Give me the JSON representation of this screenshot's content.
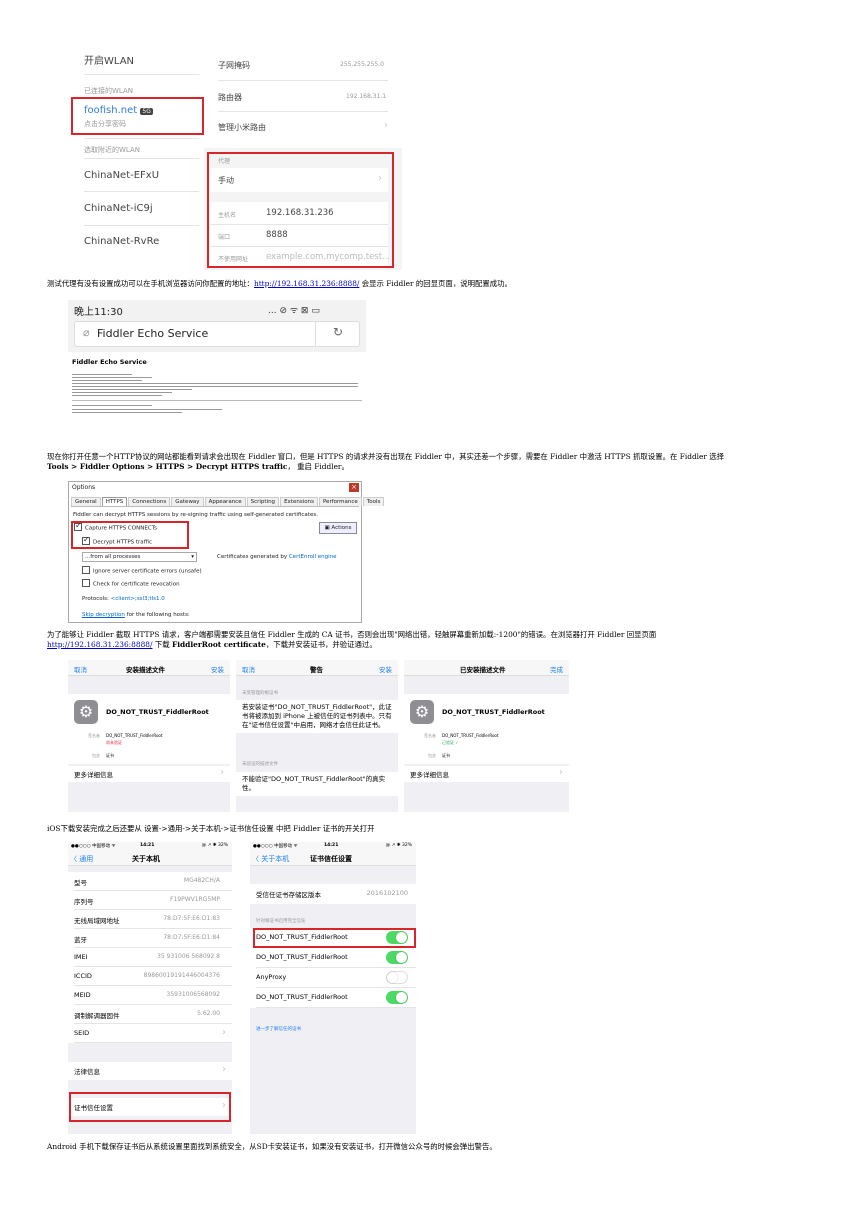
{
  "wifi": {
    "open_wlan": "开启WLAN",
    "connected_header": "已连接的WLAN",
    "network_name": "foofish.net",
    "network_badge": "5G",
    "network_sub": "点击分享密码",
    "choose_header": "选取附近的WLAN",
    "networks": [
      "ChinaNet-EFxU",
      "ChinaNet-iC9j",
      "ChinaNet-RvRe"
    ],
    "subnet_label": "子网掩码",
    "subnet_value": "255.255.255.0",
    "router_label": "路由器",
    "router_value": "192.168.31.1",
    "manage_label": "管理小米路由",
    "proxy_header": "代理",
    "proxy_mode": "手动",
    "host_label": "主机名",
    "host_value": "192.168.31.236",
    "port_label": "端口",
    "port_value": "8888",
    "bypass_label": "不使用网址",
    "bypass_placeholder": "example.com,mycomp.test..."
  },
  "para1": {
    "before": "测试代理有没有设置成功可以在手机浏览器访问你配置的地址：",
    "link": "http://192.168.31.236:8888/",
    "after": " 会显示 Fiddler 的回显页面，说明配置成功。"
  },
  "echo": {
    "time": "晚上11:30",
    "status_icons": "... ⊘ ᯤ ⊠ ▭",
    "url_text": "Fiddler Echo Service",
    "page_title": "Fiddler Echo Service"
  },
  "para2": {
    "line1": "现在你打开任意一个HTTP协议的网站都能看到请求会出现在 Fiddler 窗口，但是 HTTPS 的请求并没有出现在 Fiddler 中，其实还差一个步骤，需要在 Fiddler 中激活 HTTPS 抓取设置。在 Fiddler 选择",
    "bold": "Tools > Fiddler Options > HTTPS > Decrypt HTTPS traffic",
    "after": "， 重启 Fiddler。"
  },
  "options": {
    "title": "Options",
    "tabs": [
      "General",
      "HTTPS",
      "Connections",
      "Gateway",
      "Appearance",
      "Scripting",
      "Extensions",
      "Performance",
      "Tools"
    ],
    "intro": "Fiddler can decrypt HTTPS sessions by re-signing traffic using self-generated certificates.",
    "capture_label": "Capture HTTPS CONNECTs",
    "decrypt_label": "Decrypt HTTPS traffic",
    "actions_label": "Actions",
    "from_select": "...from all processes",
    "certs_text": "Certificates generated by ",
    "certs_link": "CertEnroll engine",
    "ignore_label": "Ignore server certificate errors (unsafe)",
    "revocation_label": "Check for certificate revocation",
    "protocols_label": "Protocols: ",
    "protocols_value": "<client>;ssl3;tls1.0",
    "skip_link": "Skip decryption",
    "skip_after": " for the following hosts:"
  },
  "para3": {
    "line1": "为了能够让 Fiddler 截取 HTTPS 请求，客户端都需要安装且信任 Fiddler 生成的 CA 证书，否则会出现\"网络出错，轻触屏幕重新加载:-1200\"的错误。在浏览器打开 Fiddler 回显页面",
    "link": "http://192.168.31.236:8888/",
    "mid": " 下载 ",
    "bold": "FiddlerRoot certificate",
    "after": "，下载并安装证书，并验证通过。"
  },
  "ios_install": {
    "cancel": "取消",
    "title": "安装描述文件",
    "install": "安装",
    "cert_name": "DO_NOT_TRUST_FiddlerRoot",
    "signed_label": "签名者",
    "signed_value": "DO_NOT_TRUST_FiddlerRoot",
    "unverified": "尚未验证",
    "contains_label": "包含",
    "contains_value": "证书",
    "more": "更多详细信息"
  },
  "ios_warning": {
    "cancel": "取消",
    "title": "警告",
    "install": "安装",
    "sec1_header": "未受管理的根证书",
    "sec1_text": "若安装证书\"DO_NOT_TRUST_FiddlerRoot\"，此证书将被添加到 iPhone 上被信任的证书列表中。只有在\"证书信任设置\"中启用，网络才会信任此证书。",
    "sec2_header": "未验证的描述文件",
    "sec2_text": "不能验证\"DO_NOT_TRUST_FiddlerRoot\"的真实性。"
  },
  "ios_installed": {
    "title": "已安装描述文件",
    "done": "完成",
    "cert_name": "DO_NOT_TRUST_FiddlerRoot",
    "signed_label": "签名者",
    "signed_value": "DO_NOT_TRUST_FiddlerRoot",
    "verified": "已验证 ✓",
    "contains_label": "包含",
    "contains_value": "证书",
    "more": "更多详细信息"
  },
  "para4": {
    "text": "iOS下载安装完成之后还要从 设置->通用->关于本机->证书信任设置 中把 Fiddler 证书的开关打开"
  },
  "about": {
    "carrier": "●●○○○ 中国移动 ᯤ",
    "time": "14:21",
    "battery": "@ ↗ ✱ 32%",
    "back": "〈 通用",
    "title": "关于本机",
    "rows": [
      {
        "label": "型号",
        "value": "MG482CH/A"
      },
      {
        "label": "序列号",
        "value": "F19PWV1RG5MP"
      },
      {
        "label": "无线局域网地址",
        "value": "78:D7:5F:E6:D1:83"
      },
      {
        "label": "蓝牙",
        "value": "78:D7:5F:E6:D1:84"
      },
      {
        "label": "IMEI",
        "value": "35 931006 568092 8"
      },
      {
        "label": "ICCID",
        "value": "89860019191446004376"
      },
      {
        "label": "MEID",
        "value": "35931006568092"
      },
      {
        "label": "调制解调器固件",
        "value": "5.62.00"
      },
      {
        "label": "SEID",
        "value": ""
      }
    ],
    "legal": "法律信息",
    "trust": "证书信任设置"
  },
  "trust": {
    "carrier": "●●○○○ 中国移动 ᯤ",
    "time": "14:21",
    "battery": "@ ↗ ✱ 32%",
    "back": "〈 关于本机",
    "title": "证书信任设置",
    "store_label": "受信任证书存储区版本",
    "store_value": "2016102100",
    "section_header": "针对根证书启用完全信任",
    "certs": [
      {
        "name": "DO_NOT_TRUST_FiddlerRoot",
        "on": "on"
      },
      {
        "name": "DO_NOT_TRUST_FiddlerRoot",
        "on": "on"
      },
      {
        "name": "AnyProxy",
        "on": "off"
      },
      {
        "name": "DO_NOT_TRUST_FiddlerRoot",
        "on": "on"
      }
    ],
    "learn_more": "进一步了解信任的证书"
  },
  "para5": {
    "text": "Android 手机下载保存证书后从系统设置里面找到系统安全，从SD卡安装证书，如果没有安装证书，打开微信公众号的时候会弹出警告。"
  }
}
